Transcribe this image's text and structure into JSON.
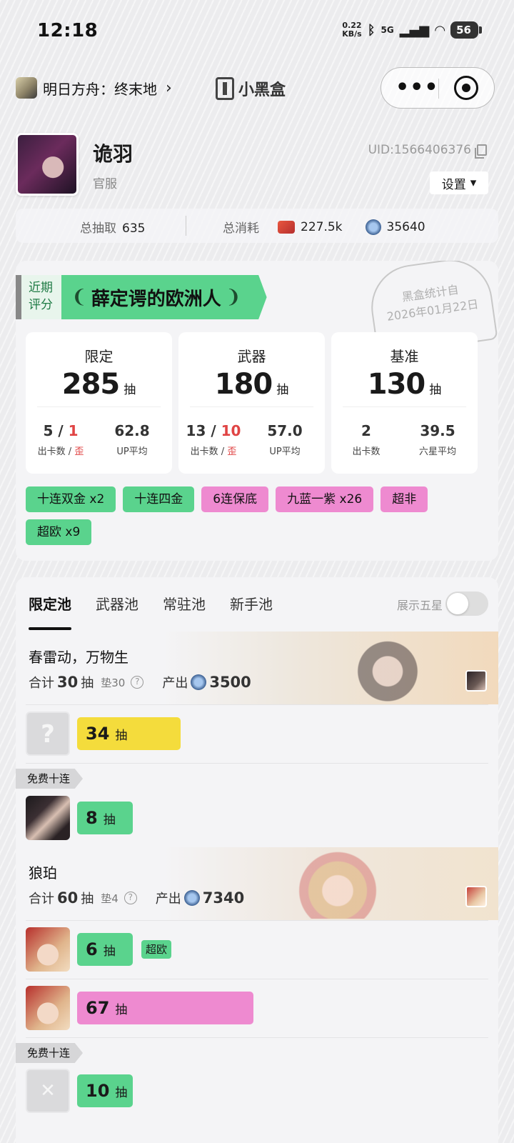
{
  "status_bar": {
    "time": "12:18",
    "net_speed_value": "0.22",
    "net_speed_unit": "KB/s",
    "network": "5G",
    "battery": "56"
  },
  "nav": {
    "game_title": "明日方舟：终末地",
    "chevron": "›",
    "brand": "小黑盒",
    "more_icon": "•••"
  },
  "profile": {
    "name": "诡羽",
    "server": "官服",
    "uid": "UID:1566406376",
    "settings_label": "设置",
    "settings_caret": "▾"
  },
  "totals": {
    "pulls_label": "总抽取",
    "pulls_value": "635",
    "spend_label": "总消耗",
    "ticket_value": "227.5k",
    "orb_value": "35640"
  },
  "rating": {
    "label_line1": "近期",
    "label_line2": "评分",
    "title": "薛定谔的欧洲人",
    "laurel_left": "❨",
    "laurel_right": "❩",
    "stamp_line1": "黑盒统计自",
    "stamp_line2": "2026年01月22日"
  },
  "stats": [
    {
      "title": "限定",
      "count": "285",
      "unit": "抽",
      "v1_a": "5",
      "v1_sep": " / ",
      "v1_b": "1",
      "l1_a": "出卡数",
      "l1_sep": " / ",
      "l1_b": "歪",
      "v2": "62.8",
      "l2": "UP平均"
    },
    {
      "title": "武器",
      "count": "180",
      "unit": "抽",
      "v1_a": "13",
      "v1_sep": " / ",
      "v1_b": "10",
      "l1_a": "出卡数",
      "l1_sep": " / ",
      "l1_b": "歪",
      "v2": "57.0",
      "l2": "UP平均"
    },
    {
      "title": "基准",
      "count": "130",
      "unit": "抽",
      "v1_a": "2",
      "l1_a": "出卡数",
      "v2": "39.5",
      "l2": "六星平均"
    }
  ],
  "tags": [
    {
      "text": "十连双金 x2",
      "color": "green"
    },
    {
      "text": "十连四金",
      "color": "green"
    },
    {
      "text": "6连保底",
      "color": "pink"
    },
    {
      "text": "九蓝一紫 x26",
      "color": "pink"
    },
    {
      "text": "超非",
      "color": "pink"
    },
    {
      "text": "超欧 x9",
      "color": "green"
    }
  ],
  "pool_tabs": [
    "限定池",
    "武器池",
    "常驻池",
    "新手池"
  ],
  "show_five_label": "展示五星",
  "banners": [
    {
      "title": "春雷动，万物生",
      "total_label": "合计",
      "total": "30",
      "unit": "抽",
      "pity": "垫30",
      "help": "?",
      "output_label": "产出",
      "output": "3500",
      "rows": [
        {
          "count": "34",
          "unit": "抽",
          "color": "yellow",
          "fill": 0.5
        }
      ],
      "free_label": "免费十连",
      "free_rows": [
        {
          "count": "8",
          "unit": "抽",
          "color": "green",
          "fill": 0.27
        }
      ]
    },
    {
      "title": "狼珀",
      "total_label": "合计",
      "total": "60",
      "unit": "抽",
      "pity": "垫4",
      "help": "?",
      "output_label": "产出",
      "output": "7340",
      "rows": [
        {
          "count": "6",
          "unit": "抽",
          "color": "green",
          "fill": 0.27,
          "tag": "超欧"
        },
        {
          "count": "67",
          "unit": "抽",
          "color": "pink",
          "fill": 0.85
        }
      ],
      "free_label": "免费十连",
      "free_rows": [
        {
          "count": "10",
          "unit": "抽",
          "color": "green",
          "fill": 0.27
        }
      ]
    }
  ]
}
